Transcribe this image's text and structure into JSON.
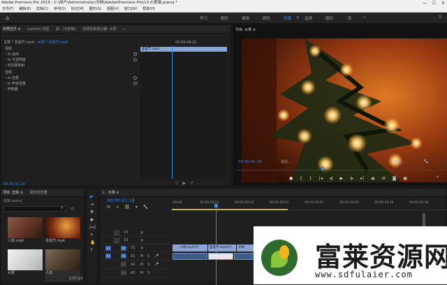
{
  "window": {
    "title": "Adobe Premiere Pro 2019 - C:\\用户\\Administrator\\文档\\Adobe\\Premiere Pro\\13.0\\剪辑.prproj *"
  },
  "menu": [
    "文件(F)",
    "编辑(E)",
    "剪辑(C)",
    "序列(S)",
    "标记(M)",
    "图形(G)",
    "视图(V)",
    "窗口(W)",
    "帮助(H)"
  ],
  "workspaces": [
    {
      "label": "学习",
      "active": false
    },
    {
      "label": "组件",
      "active": false
    },
    {
      "label": "编辑",
      "active": false
    },
    {
      "label": "颜色",
      "active": false
    },
    {
      "label": "效果",
      "active": true
    },
    {
      "label": "音频",
      "active": false
    },
    {
      "label": "图形",
      "active": false
    },
    {
      "label": "库",
      "active": false
    }
  ],
  "effect_controls": {
    "tabs": [
      "效果控件 ≡",
      "Lumetri 范围",
      "源：(无剪辑)",
      "音频剪辑混合器: 水果"
    ],
    "clip_path_master": "主要 * 圣诞节.mp4",
    "clip_path_seq": "水果 * 圣诞节.mp4",
    "header_time": "00:00:44:22",
    "clip_label": "圣诞节.mp4",
    "video_header": "视频",
    "rows": [
      {
        "label": "fx 运动",
        "reset": true
      },
      {
        "label": "fx 不透明度",
        "reset": true
      },
      {
        "label": "时间重映射",
        "reset": false
      }
    ],
    "audio_header": "音频",
    "audio_rows": [
      {
        "label": "fx 音量",
        "reset": true
      },
      {
        "label": "fx 声道音量",
        "reset": true
      },
      {
        "label": "声像器",
        "reset": false
      }
    ],
    "timecode": "00:00:41:18"
  },
  "program": {
    "tab_label": "节目: 水果 ≡",
    "timecode": "00:00:41:18",
    "fit": "适合",
    "quality": "完整"
  },
  "project": {
    "tabs": [
      "项目: 剪辑 ≡",
      "媒体浏览器"
    ],
    "file": "剪辑.prproj",
    "items": [
      {
        "name": "人間.mp4",
        "duration": "",
        "color": "#6a3d2c"
      },
      {
        "name": "圣诞节.mp4",
        "duration": "",
        "color": "#7a2a10"
      },
      {
        "name": "水果",
        "duration": "",
        "color": "#c8c8c8"
      },
      {
        "name": "人間",
        "duration": "1:07:22",
        "color": "#5a4a3a"
      }
    ]
  },
  "timeline": {
    "tab": "水果 ≡",
    "timecode": "00:00:41:18",
    "ruler": [
      ":00:00",
      "00:00:29:23",
      "00:00:59:22",
      "00:01:29:21",
      "00:01:59:21",
      "00:02:29:20",
      "00:02:59:19",
      "00:03:29:18"
    ],
    "tracks": [
      "V3",
      "V2",
      "V1",
      "A1",
      "A2",
      "A3"
    ],
    "clip_v1a": "人間.mp4[V]",
    "clip_v1b": "圣诞节.mp4[V]",
    "clip_v1c": "水果"
  },
  "watermark": {
    "brand": "富莱资源网",
    "url": "www.sdfulaier.com"
  },
  "colors": {
    "accent": "#2d8ceb",
    "clip": "#8aa4d6",
    "audio_clip": "#3c5c8c"
  }
}
